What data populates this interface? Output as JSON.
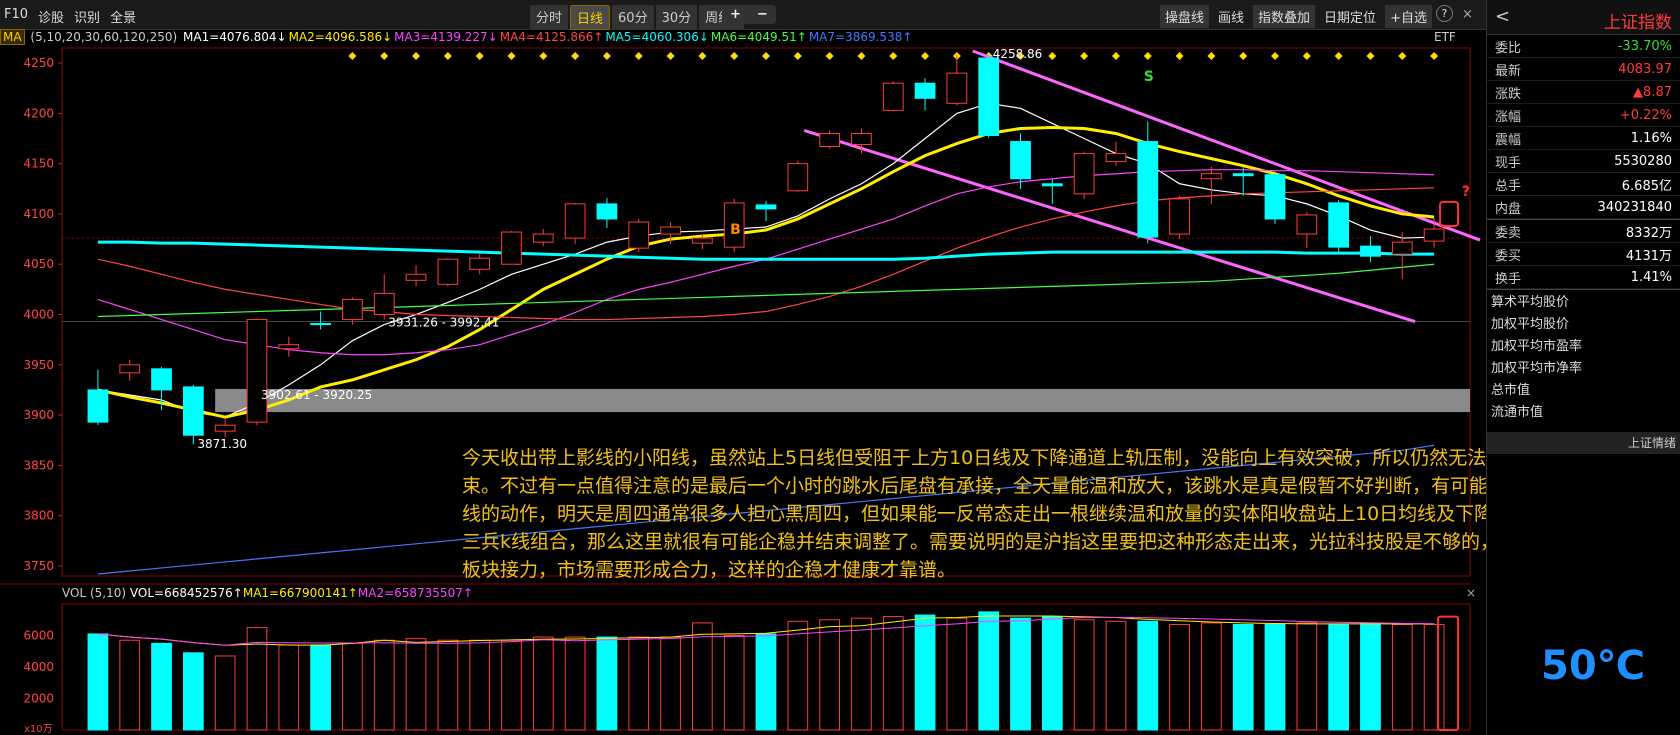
{
  "toolbar": {
    "left": [
      "F10",
      "诊股",
      "识别",
      "全景"
    ],
    "periods": [
      "分时",
      "日线",
      "60分",
      "30分",
      "周线"
    ],
    "period_suffix": "▾",
    "active_period": "日线",
    "zoom_in": "+",
    "zoom_out": "−",
    "right": [
      "操盘线",
      "画线",
      "指数叠加",
      "日期定位",
      "+自选"
    ],
    "help": "?",
    "close": "×"
  },
  "ma_bar": {
    "ma_label": "MA",
    "params": "(5,10,20,30,60,120,250)",
    "items": [
      {
        "text": "MA1=4076.804↓",
        "color": "#ffffff"
      },
      {
        "text": "MA2=4096.586↓",
        "color": "#ffee00"
      },
      {
        "text": "MA3=4139.227↓",
        "color": "#ff44ff"
      },
      {
        "text": "MA4=4125.866↑",
        "color": "#ff4444"
      },
      {
        "text": "MA5=4060.306↓",
        "color": "#00ffff"
      },
      {
        "text": "MA6=4049.51↑",
        "color": "#44ff44"
      },
      {
        "text": "MA7=3869.538↑",
        "color": "#4477ff"
      }
    ],
    "etf": "ETF"
  },
  "chart_data": {
    "type": "candlestick",
    "y_ticks": [
      4250,
      4200,
      4150,
      4100,
      4050,
      4000,
      3950,
      3900,
      3850,
      3800,
      3750
    ],
    "y_range": [
      3740,
      4265
    ],
    "candles": [
      {
        "o": 3925,
        "c": 3893,
        "h": 3945,
        "l": 3890
      },
      {
        "o": 3942,
        "c": 3950,
        "h": 3955,
        "l": 3934
      },
      {
        "o": 3946,
        "c": 3925,
        "h": 3948,
        "l": 3905
      },
      {
        "o": 3928,
        "c": 3880,
        "h": 3930,
        "l": 3871
      },
      {
        "o": 3884,
        "c": 3890,
        "h": 3897,
        "l": 3878
      },
      {
        "o": 3893,
        "c": 3995,
        "h": 3996,
        "l": 3890
      },
      {
        "o": 3966,
        "c": 3970,
        "h": 3978,
        "l": 3958
      },
      {
        "o": 3991,
        "c": 3990,
        "h": 4003,
        "l": 3985
      },
      {
        "o": 3995,
        "c": 4015,
        "h": 4017,
        "l": 3990
      },
      {
        "o": 4000,
        "c": 4021,
        "h": 4040,
        "l": 3995
      },
      {
        "o": 4034,
        "c": 4040,
        "h": 4049,
        "l": 4028
      },
      {
        "o": 4030,
        "c": 4055,
        "h": 4056,
        "l": 4028
      },
      {
        "o": 4045,
        "c": 4056,
        "h": 4060,
        "l": 4040
      },
      {
        "o": 4050,
        "c": 4082,
        "h": 4083,
        "l": 4050
      },
      {
        "o": 4072,
        "c": 4080,
        "h": 4085,
        "l": 4068
      },
      {
        "o": 4076,
        "c": 4110,
        "h": 4111,
        "l": 4070
      },
      {
        "o": 4110,
        "c": 4095,
        "h": 4116,
        "l": 4086
      },
      {
        "o": 4066,
        "c": 4092,
        "h": 4095,
        "l": 4062
      },
      {
        "o": 4080,
        "c": 4087,
        "h": 4092,
        "l": 4070
      },
      {
        "o": 4071,
        "c": 4076,
        "h": 4080,
        "l": 4065
      },
      {
        "o": 4067,
        "c": 4111,
        "h": 4115,
        "l": 4062
      },
      {
        "o": 4109,
        "c": 4105,
        "h": 4113,
        "l": 4093
      },
      {
        "o": 4123,
        "c": 4150,
        "h": 4153,
        "l": 4122
      },
      {
        "o": 4167,
        "c": 4180,
        "h": 4183,
        "l": 4165
      },
      {
        "o": 4169,
        "c": 4180,
        "h": 4185,
        "l": 4160
      },
      {
        "o": 4203,
        "c": 4230,
        "h": 4232,
        "l": 4202
      },
      {
        "o": 4230,
        "c": 4215,
        "h": 4235,
        "l": 4203
      },
      {
        "o": 4210,
        "c": 4240,
        "h": 4258,
        "l": 4208
      },
      {
        "o": 4255,
        "c": 4178,
        "h": 4258.86,
        "l": 4176
      },
      {
        "o": 4172,
        "c": 4135,
        "h": 4180,
        "l": 4125
      },
      {
        "o": 4130,
        "c": 4128,
        "h": 4135,
        "l": 4110
      },
      {
        "o": 4120,
        "c": 4160,
        "h": 4162,
        "l": 4115
      },
      {
        "o": 4152,
        "c": 4160,
        "h": 4172,
        "l": 4148
      },
      {
        "o": 4172,
        "c": 4077,
        "h": 4192,
        "l": 4071
      },
      {
        "o": 4080,
        "c": 4115,
        "h": 4118,
        "l": 4075
      },
      {
        "o": 4135,
        "c": 4140,
        "h": 4147,
        "l": 4110
      },
      {
        "o": 4140,
        "c": 4138,
        "h": 4147,
        "l": 4118
      },
      {
        "o": 4139,
        "c": 4095,
        "h": 4142,
        "l": 4090
      },
      {
        "o": 4080,
        "c": 4099,
        "h": 4102,
        "l": 4066
      },
      {
        "o": 4111,
        "c": 4067,
        "h": 4114,
        "l": 4060
      },
      {
        "o": 4068,
        "c": 4058,
        "h": 4078,
        "l": 4052
      },
      {
        "o": 4060,
        "c": 4072,
        "h": 4082,
        "l": 4035
      },
      {
        "o": 4073,
        "c": 4085,
        "h": 4096,
        "l": 4066
      }
    ],
    "ma_series": [
      {
        "name": "MA1",
        "color": "#ffffff",
        "values": [
          3925,
          3920,
          3915,
          3903,
          3898,
          3912,
          3930,
          3950,
          3974,
          3990,
          4000,
          4012,
          4025,
          4040,
          4050,
          4060,
          4072,
          4078,
          4082,
          4083,
          4085,
          4087,
          4098,
          4115,
          4130,
          4150,
          4175,
          4200,
          4210,
          4205,
          4190,
          4175,
          4160,
          4150,
          4130,
          4124,
          4120,
          4118,
          4110,
          4098,
          4084,
          4076,
          4077
        ]
      },
      {
        "name": "MA2",
        "color": "#ffee00",
        "values": [
          3925,
          3918,
          3912,
          3905,
          3898,
          3905,
          3915,
          3928,
          3935,
          3945,
          3955,
          3968,
          3985,
          4005,
          4025,
          4040,
          4055,
          4068,
          4075,
          4078,
          4080,
          4084,
          4095,
          4110,
          4125,
          4142,
          4158,
          4170,
          4180,
          4185,
          4186,
          4185,
          4180,
          4170,
          4162,
          4155,
          4148,
          4140,
          4130,
          4118,
          4108,
          4100,
          4097
        ]
      },
      {
        "name": "MA3",
        "color": "#ff44ff",
        "values": [
          4015,
          4005,
          3995,
          3985,
          3975,
          3970,
          3965,
          3962,
          3960,
          3960,
          3962,
          3965,
          3970,
          3980,
          3990,
          4002,
          4015,
          4025,
          4032,
          4040,
          4048,
          4055,
          4065,
          4075,
          4085,
          4095,
          4108,
          4120,
          4127,
          4132,
          4135,
          4138,
          4140,
          4142,
          4143,
          4144,
          4144,
          4143,
          4143,
          4142,
          4141,
          4140,
          4139
        ]
      },
      {
        "name": "MA4",
        "color": "#ff4444",
        "values": [
          4055,
          4048,
          4040,
          4032,
          4025,
          4020,
          4015,
          4010,
          4005,
          4003,
          4000,
          3999,
          3998,
          3997,
          3996,
          3995,
          3995,
          3996,
          3997,
          3998,
          4000,
          4003,
          4010,
          4018,
          4028,
          4040,
          4053,
          4066,
          4077,
          4087,
          4095,
          4102,
          4108,
          4113,
          4116,
          4118,
          4120,
          4121,
          4122,
          4123,
          4124,
          4125,
          4126
        ]
      },
      {
        "name": "MA5",
        "color": "#00ffff",
        "values": [
          4072,
          4072,
          4071,
          4071,
          4070,
          4069,
          4068,
          4067,
          4066,
          4065,
          4064,
          4063,
          4062,
          4061,
          4060,
          4059,
          4058,
          4057,
          4056,
          4055,
          4055,
          4055,
          4055,
          4055,
          4055,
          4055,
          4056,
          4058,
          4060,
          4061,
          4062,
          4062,
          4062,
          4062,
          4062,
          4062,
          4062,
          4062,
          4061,
          4061,
          4061,
          4060,
          4060
        ]
      },
      {
        "name": "MA6",
        "color": "#44ff44",
        "values": [
          3998,
          3999,
          4000,
          4001,
          4002,
          4003,
          4004,
          4005,
          4006,
          4007,
          4008,
          4009,
          4010,
          4011,
          4012,
          4013,
          4014,
          4015,
          4016,
          4017,
          4018,
          4019,
          4020,
          4021,
          4022,
          4023,
          4024,
          4025,
          4026,
          4027,
          4028,
          4029,
          4030,
          4031,
          4032,
          4033,
          4035,
          4037,
          4039,
          4041,
          4044,
          4047,
          4050
        ]
      },
      {
        "name": "MA7",
        "color": "#4477ff",
        "values": [
          3742,
          3745,
          3748,
          3751,
          3754,
          3757,
          3760,
          3763,
          3766,
          3769,
          3772,
          3775,
          3778,
          3781,
          3784,
          3787,
          3790,
          3793,
          3796,
          3799,
          3802,
          3805,
          3808,
          3811,
          3814,
          3817,
          3820,
          3823,
          3826,
          3829,
          3832,
          3835,
          3838,
          3841,
          3844,
          3847,
          3850,
          3853,
          3856,
          3859,
          3862,
          3865,
          3870
        ]
      }
    ],
    "price_labels": [
      {
        "text": "4258.86",
        "x": 28,
        "y": 4258.86
      },
      {
        "text": "3931.26 - 3992.41",
        "x": 9,
        "y": 3992
      },
      {
        "text": "3902.61 - 3920.25",
        "x": 5,
        "y": 3920
      },
      {
        "text": "3871.30",
        "x": 3,
        "y": 3871.3
      }
    ],
    "markers": [
      {
        "text": "B",
        "x": 20,
        "y": 4080,
        "color": "#ff8800"
      },
      {
        "text": "S",
        "x": 33,
        "y": 4232,
        "color": "#33dd33"
      },
      {
        "text": "?",
        "x": 43,
        "y": 4118,
        "color": "#ff3333"
      }
    ],
    "zone": {
      "y_top": 3926,
      "y_bottom": 3903
    },
    "volume": {
      "header_label": "VOL",
      "params": "(5,10)",
      "items": [
        {
          "text": "VOL=668452576↑",
          "color": "#ffffff"
        },
        {
          "text": "MA1=667900141↑",
          "color": "#ffee00"
        },
        {
          "text": "MA2=658735507↑",
          "color": "#ff44ff"
        }
      ],
      "y_ticks": [
        6000,
        4000,
        2000
      ],
      "unit": "x10万",
      "values": [
        6100,
        5700,
        5500,
        4900,
        4700,
        6500,
        5400,
        5400,
        5500,
        5700,
        5800,
        5700,
        5700,
        5700,
        5900,
        5900,
        5900,
        5900,
        5900,
        6800,
        6000,
        6100,
        6900,
        7000,
        7100,
        7200,
        7300,
        7100,
        7500,
        7100,
        7200,
        7000,
        6900,
        6900,
        6700,
        6800,
        6700,
        6700,
        6800,
        6700,
        6800,
        6700,
        6700
      ]
    }
  },
  "annotation": "今天收出带上影线的小阳线，虽然站上5日线但受阻于上方10日线及下降通道上轨压制，没能向上有效突破，所以仍然无法判定这里调整趋势结束。不过有一点值得注意的是最后一个小时的跳水后尾盘有承接，全天量能温和放大，该跳水是真是假暂不好判断，有可能是消化上方10日均线的动作，明天是周四通常很多人担心黑周四，但如果能一反常态走出一根继续温和放量的实体阳收盘站上10日均线及下降通道上轨，组成红三兵k线组合，那么这里就很有可能企稳并结束调整了。需要说明的是沪指这里要把这种形态走出来，光拉科技股是不够的，需要大金融等其他板块接力，市场需要形成合力，这样的企稳才健康才靠谱。",
  "right_panel": {
    "back": "<",
    "title": "上证指数",
    "rows": [
      {
        "label": "委比",
        "value": "-33.70%",
        "color": "#33dd33"
      },
      {
        "label": "最新",
        "value": "4083.97",
        "color": "#ff3b3b"
      },
      {
        "label": "涨跌",
        "value": "▲8.87",
        "color": "#ff3b3b"
      },
      {
        "label": "涨幅",
        "value": "+0.22%",
        "color": "#ff3b3b"
      },
      {
        "label": "震幅",
        "value": "1.16%",
        "color": "#ffffff"
      },
      {
        "label": "现手",
        "value": "5530280",
        "color": "#ffffff"
      },
      {
        "label": "总手",
        "value": "6.685亿",
        "color": "#ffffff"
      },
      {
        "label": "内盘",
        "value": "340231840",
        "color": "#ffffff"
      }
    ],
    "rows2": [
      {
        "label": "委卖",
        "value": "8332万",
        "color": "#ffffff"
      },
      {
        "label": "委买",
        "value": "4131万",
        "color": "#ffffff"
      },
      {
        "label": "换手",
        "value": "1.41%",
        "color": "#ffffff"
      }
    ],
    "list": [
      "算术平均股价",
      "加权平均股价",
      "加权平均市盈率",
      "加权平均市净率",
      "总市值",
      "流通市值"
    ],
    "tab": "上证情绪",
    "temperature": "50℃"
  },
  "colors": {
    "up": "#ff3b3b",
    "down": "#00ffff",
    "annotation": "#f0c01a",
    "channel": "#ff66ff"
  }
}
